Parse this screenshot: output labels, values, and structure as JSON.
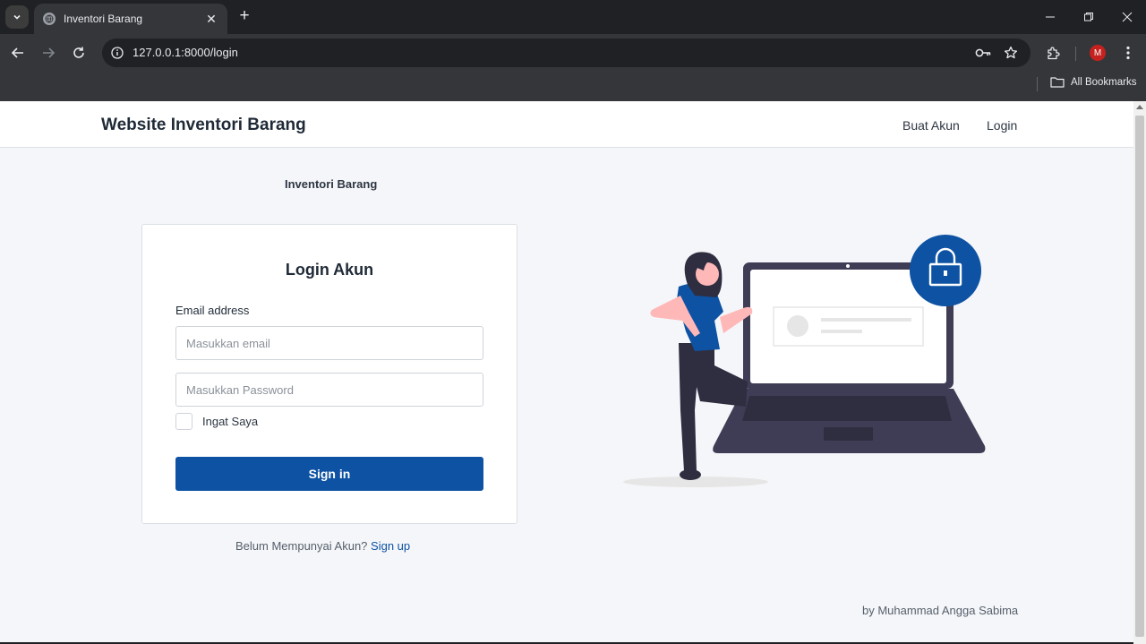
{
  "browser": {
    "tab_title": "Inventori Barang",
    "url": "127.0.0.1:8000/login",
    "profile_initial": "M",
    "bookmarks_label": "All Bookmarks"
  },
  "site": {
    "brand": "Website Inventori Barang",
    "nav": [
      "Buat Akun",
      "Login"
    ]
  },
  "page": {
    "section_title": "Inventori Barang",
    "login_card": {
      "title": "Login Akun",
      "email_label": "Email address",
      "email_placeholder": "Masukkan email",
      "password_placeholder": "Masukkan Password",
      "remember_label": "Ingat Saya",
      "remember_checked": false,
      "submit_label": "Sign in"
    },
    "signup_prompt": "Belum Mempunyai Akun?",
    "signup_link": "Sign up",
    "footer_credit": "by Muhammad Angga Sabima"
  },
  "colors": {
    "primary": "#0d52a3",
    "page_background": "#f5f6f9",
    "illustration_accent": "#0d52a3",
    "laptop": "#3f3d56"
  }
}
